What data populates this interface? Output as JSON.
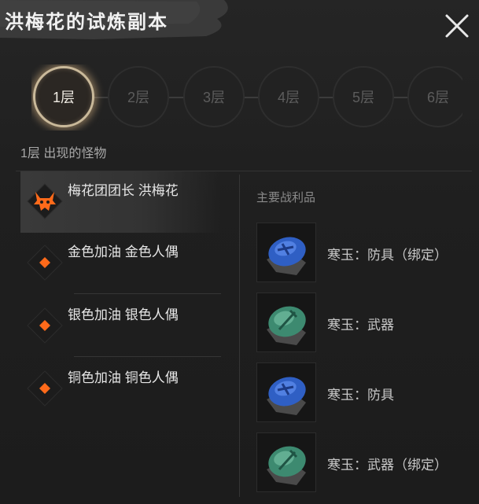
{
  "title": "洪梅花的试炼副本",
  "floors": [
    {
      "label": "1层",
      "active": true
    },
    {
      "label": "2层",
      "active": false
    },
    {
      "label": "3层",
      "active": false
    },
    {
      "label": "4层",
      "active": false
    },
    {
      "label": "5层",
      "active": false
    },
    {
      "label": "6层",
      "active": false
    }
  ],
  "floor_caption": "1层 出现的怪物",
  "monsters": [
    {
      "name": "梅花团团长 洪梅花",
      "icon": "boss-demon-icon",
      "selected": true
    },
    {
      "name": "金色加油 金色人偶",
      "icon": "diamond-marker-icon",
      "selected": false
    },
    {
      "name": "银色加油 银色人偶",
      "icon": "diamond-marker-icon",
      "selected": false
    },
    {
      "name": "铜色加油 铜色人偶",
      "icon": "diamond-marker-icon",
      "selected": false
    }
  ],
  "loot_title": "主要战利品",
  "loot": [
    {
      "name": "寒玉：防具（绑定）",
      "icon": "blue-jade-icon"
    },
    {
      "name": "寒玉：武器",
      "icon": "green-jade-icon"
    },
    {
      "name": "寒玉：防具",
      "icon": "blue-jade-icon"
    },
    {
      "name": "寒玉：武器（绑定）",
      "icon": "green-jade-icon"
    }
  ],
  "colors": {
    "accent_orange": "#ff6a1a",
    "active_ring": "#c9b99a",
    "blue_jade": "#2f5fc4",
    "green_jade": "#3d8a70"
  }
}
